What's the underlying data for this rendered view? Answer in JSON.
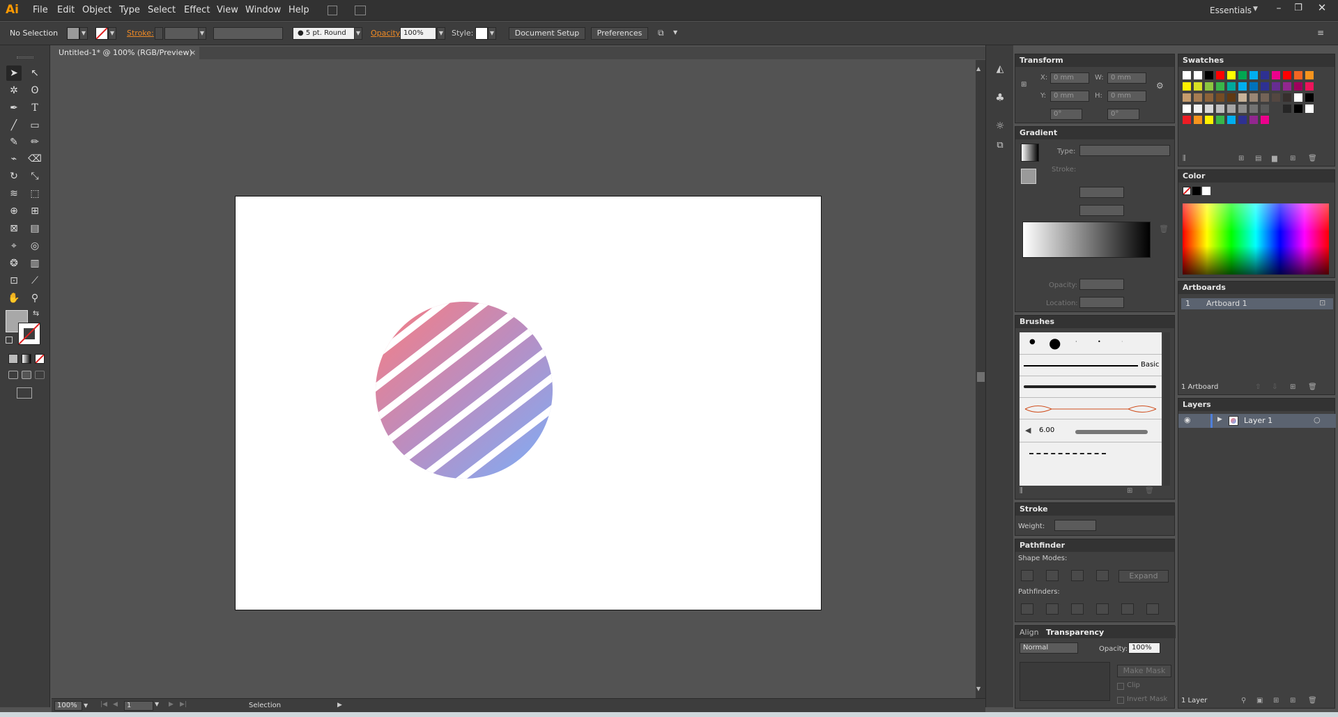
{
  "app": {
    "logo": "Ai",
    "workspace": "Essentials"
  },
  "menu": [
    "File",
    "Edit",
    "Object",
    "Type",
    "Select",
    "Effect",
    "View",
    "Window",
    "Help"
  ],
  "control": {
    "selection": "No Selection",
    "stroke_label": "Stroke:",
    "brush": "5 pt. Round",
    "opacity_label": "Opacity:",
    "opacity": "100%",
    "style_label": "Style:",
    "doc_setup": "Document Setup",
    "preferences": "Preferences"
  },
  "document": {
    "tab": "Untitled-1* @ 100% (RGB/Preview)",
    "close": "×"
  },
  "status": {
    "zoom": "100%",
    "page": "1",
    "tool": "Selection"
  },
  "transform": {
    "title": "Transform",
    "x_label": "X:",
    "x": "0 mm",
    "y_label": "Y:",
    "y": "0 mm",
    "w_label": "W:",
    "w": "0 mm",
    "h_label": "H:",
    "h": "0 mm",
    "rot": "0°",
    "shear": "0°"
  },
  "gradient": {
    "title": "Gradient",
    "type_label": "Type:",
    "stroke_label": "Stroke:",
    "opacity_label": "Opacity:",
    "location_label": "Location:"
  },
  "brushes": {
    "title": "Brushes",
    "basic": "Basic",
    "size": "6.00"
  },
  "stroke": {
    "title": "Stroke",
    "weight_label": "Weight:"
  },
  "pathfinder": {
    "title": "Pathfinder",
    "shape_modes": "Shape Modes:",
    "expand": "Expand",
    "pathfinders": "Pathfinders:"
  },
  "transparency": {
    "align_tab": "Align",
    "title": "Transparency",
    "mode": "Normal",
    "opacity_label": "Opacity:",
    "opacity": "100%",
    "make_mask": "Make Mask",
    "clip": "Clip",
    "invert_mask": "Invert Mask"
  },
  "swatches": {
    "title": "Swatches"
  },
  "color": {
    "title": "Color"
  },
  "artboards": {
    "title": "Artboards",
    "items": [
      {
        "num": "1",
        "name": "Artboard 1"
      }
    ],
    "count": "1 Artboard"
  },
  "layers": {
    "title": "Layers",
    "items": [
      {
        "name": "Layer 1"
      }
    ],
    "count": "1 Layer"
  },
  "colors": {
    "stripe_top": "#ff7b7b",
    "stripe_mid": "#b98ec2",
    "stripe_bottom": "#74b2ff",
    "accent": "#ff9a00"
  }
}
